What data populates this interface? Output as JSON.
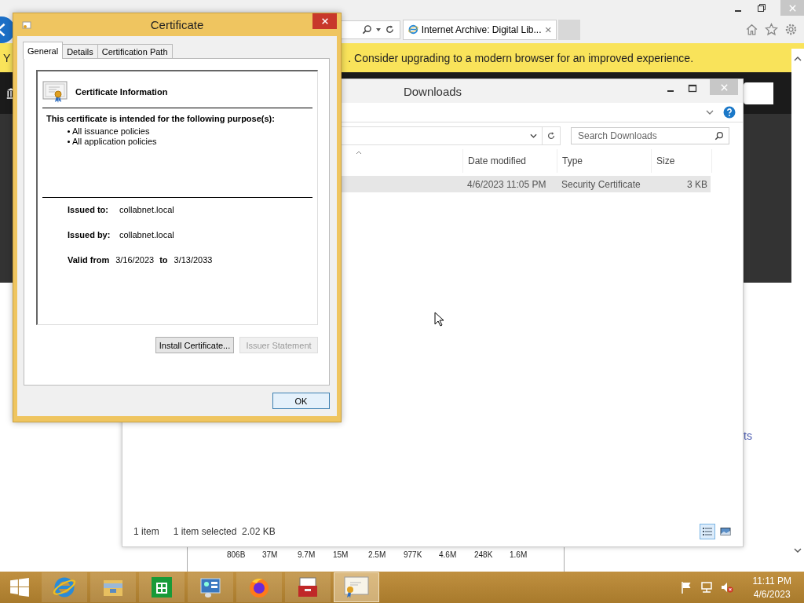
{
  "browser": {
    "tab": {
      "title": "Internet Archive: Digital Lib...",
      "selected": true
    },
    "notice": {
      "fragment": "Y",
      "text": ". Consider upgrading to a modern browser for an improved experience."
    },
    "page": {
      "link_fragment": "ts",
      "file_sizes": [
        "806B",
        "37M",
        "9.7M",
        "15M",
        "2.5M",
        "977K",
        "4.6M",
        "248K",
        "1.6M"
      ]
    }
  },
  "explorer": {
    "title": "Downloads",
    "search": {
      "placeholder": "Search Downloads"
    },
    "columns": [
      {
        "label": "Date modified"
      },
      {
        "label": "Type"
      },
      {
        "label": "Size"
      }
    ],
    "rows": [
      {
        "cells": [
          "4/6/2023 11:05 PM",
          "Security Certificate",
          "3 KB"
        ],
        "selected": true
      }
    ],
    "status": {
      "count": "1 item",
      "selection": "1 item selected  2.02 KB"
    },
    "views": [
      {
        "kind": "details",
        "selected": true
      },
      {
        "kind": "preview",
        "selected": false
      }
    ]
  },
  "dialog": {
    "title": "Certificate",
    "tabs": [
      {
        "label": "General",
        "selected": true
      },
      {
        "label": "Details",
        "selected": false
      },
      {
        "label": "Certification Path",
        "selected": false
      }
    ],
    "heading": "Certificate Information",
    "purpose_title": "This certificate is intended for the following purpose(s):",
    "purposes": [
      "All issuance policies",
      "All application policies"
    ],
    "fields": [
      {
        "label": "Issued to:",
        "value": "collabnet.local"
      },
      {
        "label": "Issued by:",
        "value": "collabnet.local"
      }
    ],
    "validity": {
      "label": "Valid from",
      "from": "3/16/2023",
      "to_label": "to",
      "to": "3/13/2033"
    },
    "buttons": [
      {
        "label": "Install Certificate...",
        "disabled": false
      },
      {
        "label": "Issuer Statement",
        "disabled": true
      }
    ],
    "ok": "OK"
  },
  "taskbar": {
    "apps": [
      {
        "kind": "ie",
        "selected": false
      },
      {
        "kind": "folder",
        "selected": false
      },
      {
        "kind": "store",
        "selected": false
      },
      {
        "kind": "panel",
        "selected": false
      },
      {
        "kind": "firefox",
        "selected": false
      },
      {
        "kind": "toolbox",
        "selected": false
      },
      {
        "kind": "certificate",
        "selected": true
      }
    ],
    "time": "11:11 PM",
    "date": "4/6/2023"
  }
}
